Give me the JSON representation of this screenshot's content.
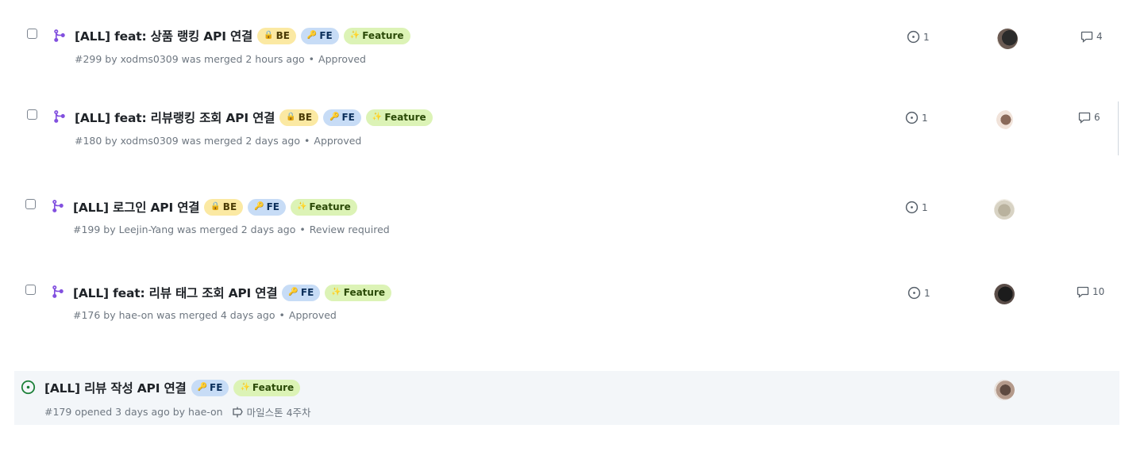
{
  "pull_requests": [
    {
      "state": "merged",
      "title": "[ALL] feat: 상품 랭킹 API 연결",
      "labels": [
        {
          "icon": "🔒",
          "text": "BE"
        },
        {
          "icon": "🔑",
          "text": "FE"
        },
        {
          "icon": "✨",
          "text": "Feature"
        }
      ],
      "meta": "#299 by xodms0309 was merged 2 hours ago",
      "review": "Approved",
      "linked_count": "1",
      "comment_count": "4"
    },
    {
      "state": "merged",
      "title": "[ALL] feat: 리뷰랭킹 조회 API 연결",
      "labels": [
        {
          "icon": "🔒",
          "text": "BE"
        },
        {
          "icon": "🔑",
          "text": "FE"
        },
        {
          "icon": "✨",
          "text": "Feature"
        }
      ],
      "meta": "#180 by xodms0309 was merged 2 days ago",
      "review": "Approved",
      "linked_count": "1",
      "comment_count": "6"
    },
    {
      "state": "merged",
      "title": "[ALL] 로그인 API 연결",
      "labels": [
        {
          "icon": "🔒",
          "text": "BE"
        },
        {
          "icon": "🔑",
          "text": "FE"
        },
        {
          "icon": "✨",
          "text": "Feature"
        }
      ],
      "meta": "#199 by Leejin-Yang was merged 2 days ago",
      "review": "Review required",
      "linked_count": "1",
      "comment_count": ""
    },
    {
      "state": "merged",
      "title": "[ALL] feat: 리뷰 태그 조회 API 연결",
      "labels": [
        {
          "icon": "🔑",
          "text": "FE"
        },
        {
          "icon": "✨",
          "text": "Feature"
        }
      ],
      "meta": "#176 by hae-on was merged 4 days ago",
      "review": "Approved",
      "linked_count": "1",
      "comment_count": "10"
    },
    {
      "state": "open",
      "title": "[ALL] 리뷰 작성 API 연결",
      "labels": [
        {
          "icon": "🔑",
          "text": "FE"
        },
        {
          "icon": "✨",
          "text": "Feature"
        }
      ],
      "meta": "#179 opened 3 days ago by hae-on",
      "milestone": "마일스톤 4주차"
    }
  ],
  "colors": {
    "merged": "#8250df",
    "open": "#1a7f37",
    "label_be": "#fbe9a3",
    "label_fe": "#c7dcf6",
    "label_feature": "#dcf3b6"
  }
}
